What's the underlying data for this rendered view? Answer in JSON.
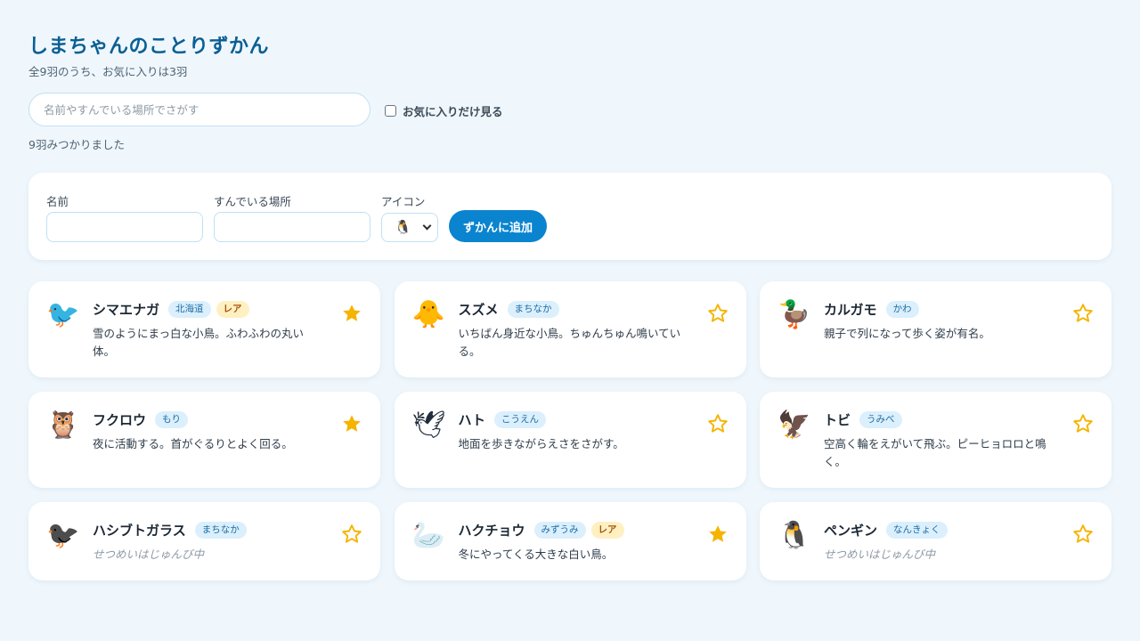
{
  "app": {
    "title": "しまちゃんのことりずかん",
    "subtitle": "全9羽のうち、お気に入りは3羽"
  },
  "search": {
    "placeholder": "名前やすんでいる場所でさがす",
    "value": "",
    "favorites_only_label": "お気に入りだけ見る",
    "favorites_only_checked": false,
    "result_text": "9羽みつかりました"
  },
  "add_form": {
    "name_label": "名前",
    "name_value": "",
    "place_label": "すんでいる場所",
    "place_value": "",
    "icon_label": "アイコン",
    "icon_selected": "🐧",
    "submit_label": "ずかんに追加"
  },
  "colors": {
    "accent": "#0a84cf",
    "title": "#0a5f94",
    "star": "#f5b400",
    "tag_bg": "#dbeffc",
    "rare_bg": "#fff0c2"
  },
  "birds": [
    {
      "icon": "🐦",
      "name": "シマエナガ",
      "place": "北海道",
      "rare": "レア",
      "desc": "雪のようにまっ白な小鳥。ふわふわの丸い体。",
      "favorite": true
    },
    {
      "icon": "🐥",
      "name": "スズメ",
      "place": "まちなか",
      "rare": "",
      "desc": "いちばん身近な小鳥。ちゅんちゅん鳴いている。",
      "favorite": false
    },
    {
      "icon": "🦆",
      "name": "カルガモ",
      "place": "かわ",
      "rare": "",
      "desc": "親子で列になって歩く姿が有名。",
      "favorite": false
    },
    {
      "icon": "🦉",
      "name": "フクロウ",
      "place": "もり",
      "rare": "",
      "desc": "夜に活動する。首がぐるりとよく回る。",
      "favorite": true
    },
    {
      "icon": "🕊",
      "name": "ハト",
      "place": "こうえん",
      "rare": "",
      "desc": "地面を歩きながらえさをさがす。",
      "favorite": false
    },
    {
      "icon": "🦅",
      "name": "トビ",
      "place": "うみべ",
      "rare": "",
      "desc": "空高く輪をえがいて飛ぶ。ピーヒョロロと鳴く。",
      "favorite": false
    },
    {
      "icon": "🐦‍⬛",
      "name": "ハシブトガラス",
      "place": "まちなか",
      "rare": "",
      "desc": "せつめいはじゅんび中",
      "pending": true,
      "favorite": false
    },
    {
      "icon": "🦢",
      "name": "ハクチョウ",
      "place": "みずうみ",
      "rare": "レア",
      "desc": "冬にやってくる大きな白い鳥。",
      "favorite": true
    },
    {
      "icon": "🐧",
      "name": "ペンギン",
      "place": "なんきょく",
      "rare": "",
      "desc": "せつめいはじゅんび中",
      "pending": true,
      "favorite": false
    }
  ]
}
